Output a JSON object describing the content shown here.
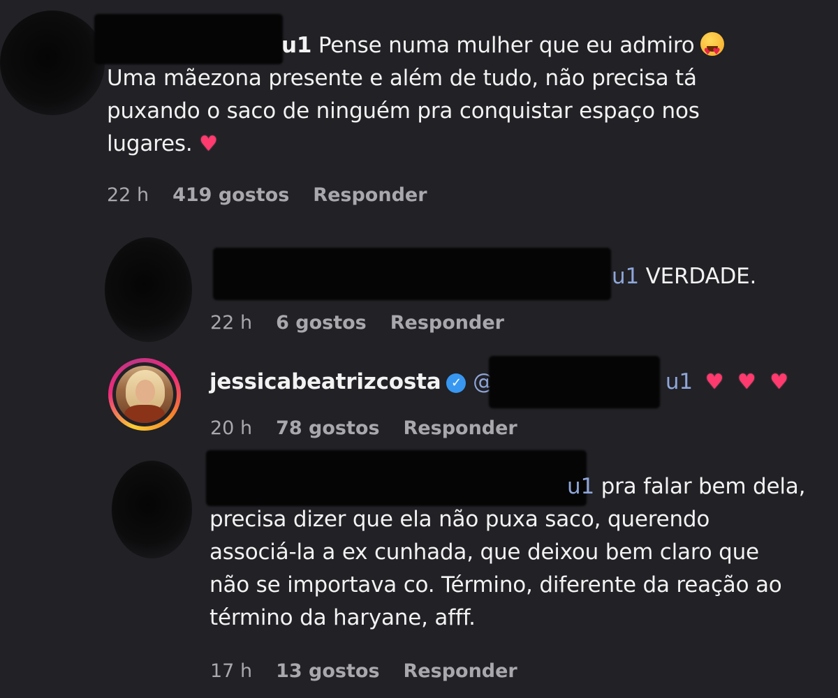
{
  "comments": [
    {
      "username_suffix": "u1",
      "text_line1": " Pense numa mulher que eu admiro",
      "text_rest": [
        "Uma mãezona presente e além de tudo, não precisa tá",
        "puxando o saco de ninguém pra conquistar espaço nos",
        "lugares."
      ],
      "emoji": "star-struck-icon",
      "time": "22 h",
      "likes": "419 gostos",
      "reply": "Responder"
    },
    {
      "username_suffix": "u1",
      "text": " VERDADE.",
      "time": "22 h",
      "likes": "6 gostos",
      "reply": "Responder"
    },
    {
      "username": "jessicabeatrizcosta",
      "verified": true,
      "mention_prefix": "@",
      "mention_suffix": "u1",
      "time": "20 h",
      "likes": "78 gostos",
      "reply": "Responder",
      "hearts": 3
    },
    {
      "username_suffix": "u1",
      "text_line1": " pra falar bem dela,",
      "text_rest": [
        "precisa dizer que ela não puxa saco, querendo",
        "associá-la a ex cunhada, que deixou bem claro que",
        "não se importava co. Término, diferente da reação ao",
        "término da haryane, afff."
      ],
      "time": "17 h",
      "likes": "13 gostos",
      "reply": "Responder"
    }
  ],
  "colors": {
    "background": "#212126",
    "text": "#f2f2f2",
    "meta": "#a8a8ad",
    "mention": "#8fa6d9",
    "heart": "#ff3a6e",
    "verified": "#3897f0"
  }
}
